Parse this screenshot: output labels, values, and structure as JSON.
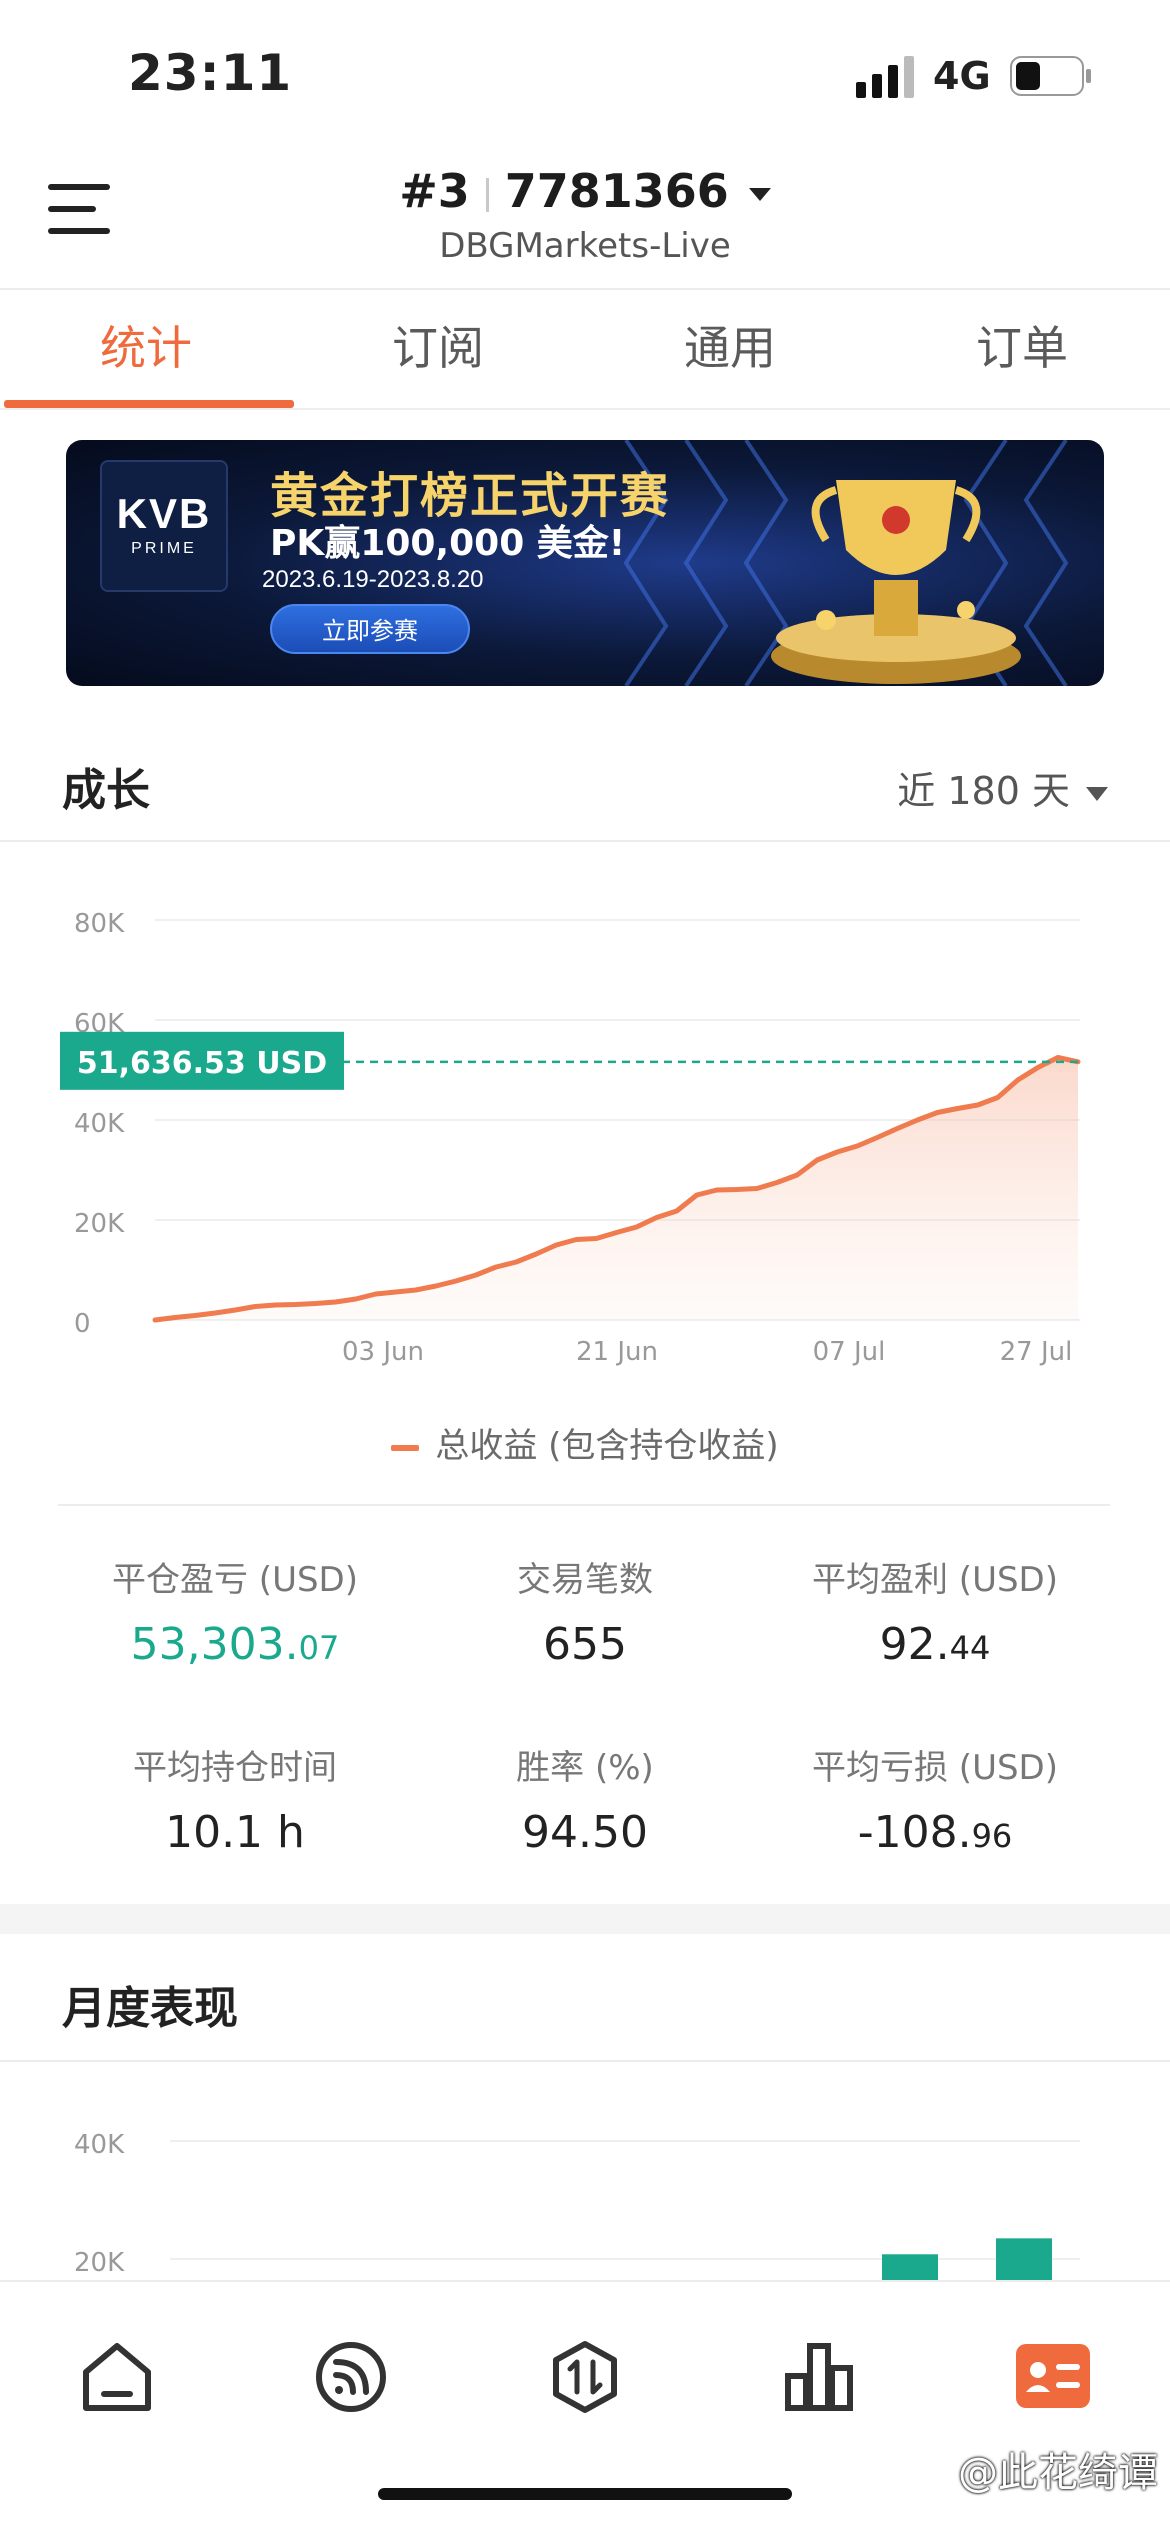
{
  "status": {
    "time": "23:11",
    "network": "4G"
  },
  "header": {
    "rank": "#3",
    "account_id": "7781366",
    "server": "DBGMarkets-Live"
  },
  "tabs": [
    {
      "label": "统计",
      "active": true
    },
    {
      "label": "订阅",
      "active": false
    },
    {
      "label": "通用",
      "active": false
    },
    {
      "label": "订单",
      "active": false
    }
  ],
  "banner": {
    "logo": "KVB",
    "logo_sub": "PRIME",
    "title": "黄金打榜正式开赛",
    "prize": "PK赢100,000 美金!",
    "dates": "2023.6.19-2023.8.20",
    "button": "立即参赛"
  },
  "growth": {
    "title": "成长",
    "range": "近 180 天",
    "current_label": "51,636.53 USD",
    "legend": "总收益 (包含持仓收益)"
  },
  "chart_data": {
    "type": "area",
    "title": "",
    "xlabel": "",
    "ylabel": "",
    "y_ticks": [
      "0",
      "20K",
      "40K",
      "60K",
      "80K"
    ],
    "x_ticks": [
      "03 Jun",
      "21 Jun",
      "07 Jul",
      "27 Jul"
    ],
    "ylim": [
      0,
      80000
    ],
    "grid": true,
    "reference_value": 51636.53,
    "series": [
      {
        "values": [
          0,
          500,
          900,
          1400,
          2000,
          2700,
          3000,
          3100,
          3300,
          3600,
          4200,
          5200,
          5600,
          6000,
          6800,
          7800,
          9000,
          10600,
          11600,
          13200,
          15000,
          16100,
          16300,
          17500,
          18600,
          20500,
          21800,
          25000,
          26000,
          26100,
          26300,
          27500,
          29000,
          32000,
          33600,
          34800,
          36500,
          38300,
          40000,
          41500,
          42300,
          43000,
          44500,
          48000,
          50500,
          52500,
          51636.53
        ]
      }
    ],
    "color": "#ef7b4e"
  },
  "stats": [
    {
      "label": "平仓盈亏 (USD)",
      "value_int": "53,303.",
      "value_dec": "07",
      "color": "green"
    },
    {
      "label": "交易笔数",
      "value_int": "655",
      "value_dec": ""
    },
    {
      "label": "平均盈利 (USD)",
      "value_int": "92.",
      "value_dec": "44"
    },
    {
      "label": "平均持仓时间",
      "value_int": "10.1 h",
      "value_dec": ""
    },
    {
      "label": "胜率 (%)",
      "value_int": "94.50",
      "value_dec": ""
    },
    {
      "label": "平均亏损 (USD)",
      "value_int": "-108.",
      "value_dec": "96"
    }
  ],
  "monthly": {
    "title": "月度表现",
    "y_ticks": [
      "20K",
      "40K"
    ],
    "visible_bars": [
      {
        "value": 20800
      },
      {
        "value": 23500
      }
    ],
    "bar_color": "#1aa98c"
  },
  "nav": [
    {
      "icon": "home-icon"
    },
    {
      "icon": "signal-icon"
    },
    {
      "icon": "trade-icon"
    },
    {
      "icon": "stats-icon"
    },
    {
      "icon": "profile-icon"
    }
  ],
  "watermark": "@此花绮谭"
}
